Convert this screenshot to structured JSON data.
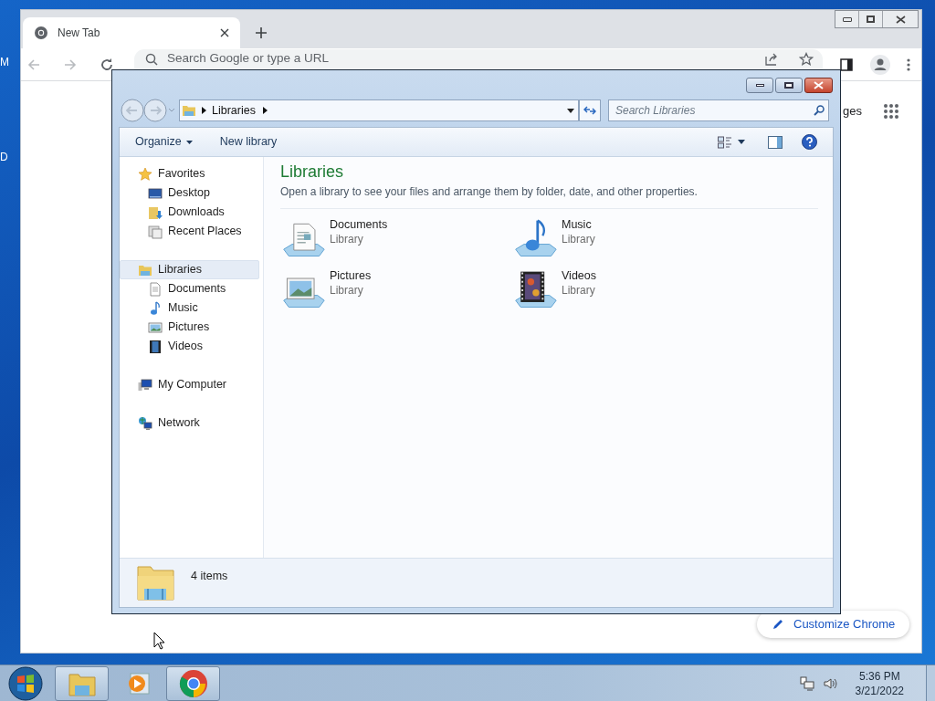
{
  "desktop": {
    "icon_labels": [
      "M",
      "D"
    ]
  },
  "browser": {
    "tabs": [
      {
        "title": "New Tab",
        "selected": true
      }
    ],
    "omnibox": {
      "placeholder": "Search Google or type a URL"
    },
    "partial_link": "ges",
    "customize_button": "Customize Chrome"
  },
  "explorer": {
    "breadcrumb": [
      "Libraries"
    ],
    "search": {
      "placeholder": "Search Libraries"
    },
    "toolbar": [
      "Organize",
      "New library"
    ],
    "nav": [
      {
        "label": "Favorites",
        "kind": "star",
        "selected": false,
        "children": [
          {
            "label": "Desktop",
            "kind": "desktop",
            "selected": false
          },
          {
            "label": "Downloads",
            "kind": "downloads",
            "selected": false
          },
          {
            "label": "Recent Places",
            "kind": "recent",
            "selected": false
          }
        ]
      },
      {
        "label": "Libraries",
        "kind": "libraries",
        "selected": true,
        "children": [
          {
            "label": "Documents",
            "kind": "documents",
            "selected": false
          },
          {
            "label": "Music",
            "kind": "music",
            "selected": false
          },
          {
            "label": "Pictures",
            "kind": "pictures",
            "selected": false
          },
          {
            "label": "Videos",
            "kind": "videos",
            "selected": false
          }
        ]
      },
      {
        "label": "My Computer",
        "kind": "computer",
        "selected": false
      },
      {
        "label": "Network",
        "kind": "network",
        "selected": false
      }
    ],
    "heading": "Libraries",
    "description": "Open a library to see your files and arrange them by folder, date, and other properties.",
    "libraries": [
      {
        "name": "Documents",
        "type": "Library",
        "kind": "documents"
      },
      {
        "name": "Music",
        "type": "Library",
        "kind": "music"
      },
      {
        "name": "Pictures",
        "type": "Library",
        "kind": "pictures"
      },
      {
        "name": "Videos",
        "type": "Library",
        "kind": "videos"
      }
    ],
    "status": "4 items"
  },
  "taskbar": {
    "buttons": [
      {
        "kind": "explorer",
        "running": true
      },
      {
        "kind": "media",
        "running": false
      },
      {
        "kind": "chrome",
        "running": true
      }
    ],
    "time": "5:36 PM",
    "date": "3/21/2022"
  }
}
